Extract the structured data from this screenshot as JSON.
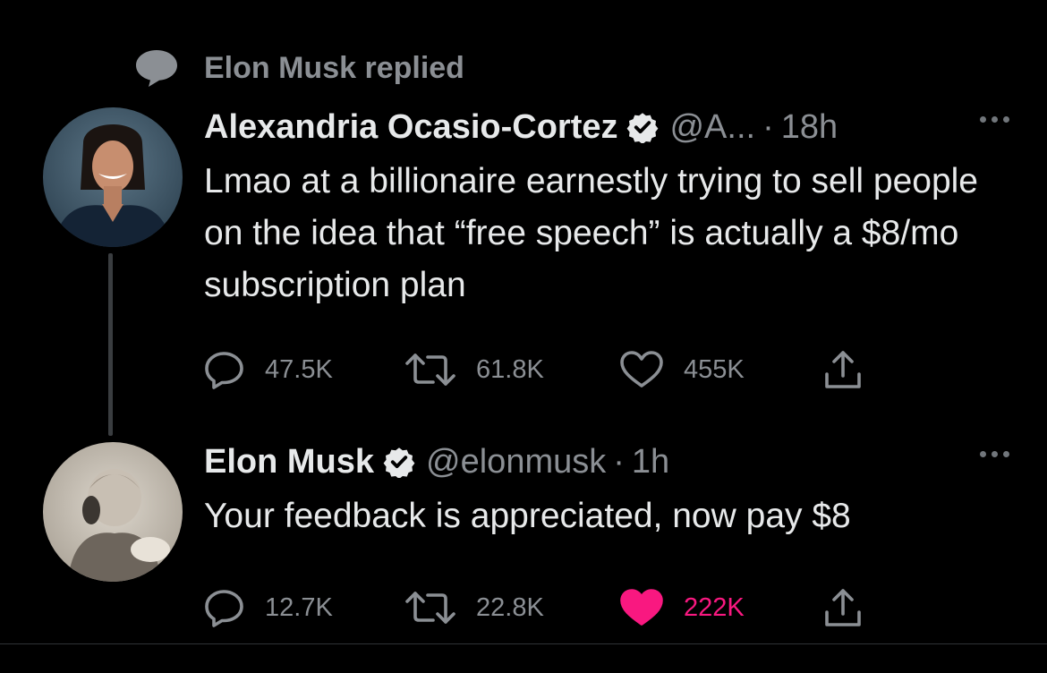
{
  "social_context": {
    "text": "Elon Musk replied"
  },
  "tweets": [
    {
      "name": "Alexandria Ocasio-Cortez",
      "handle": "@A...",
      "separator": "·",
      "time": "18h",
      "text": "Lmao at a billionaire earnestly trying to sell people on the idea that “free speech” is actually a $8/mo subscription plan",
      "replies": "47.5K",
      "retweets": "61.8K",
      "likes": "455K",
      "liked": false
    },
    {
      "name": "Elon Musk",
      "handle": "@elonmusk",
      "separator": "·",
      "time": "1h",
      "text": "Your feedback is appreciated, now pay $8",
      "replies": "12.7K",
      "retweets": "22.8K",
      "likes": "222K",
      "liked": true
    }
  ],
  "icons": {
    "context": "speech-bubble-icon",
    "verified": "verified-badge-icon",
    "more": "more-options-icon",
    "reply": "reply-icon",
    "retweet": "retweet-icon",
    "like": "heart-icon",
    "share": "share-icon"
  },
  "colors": {
    "background": "#000000",
    "text_primary": "#e7e9ea",
    "text_secondary": "#8b8f94",
    "like_active": "#f91880",
    "thread_line": "#3a3d40"
  }
}
